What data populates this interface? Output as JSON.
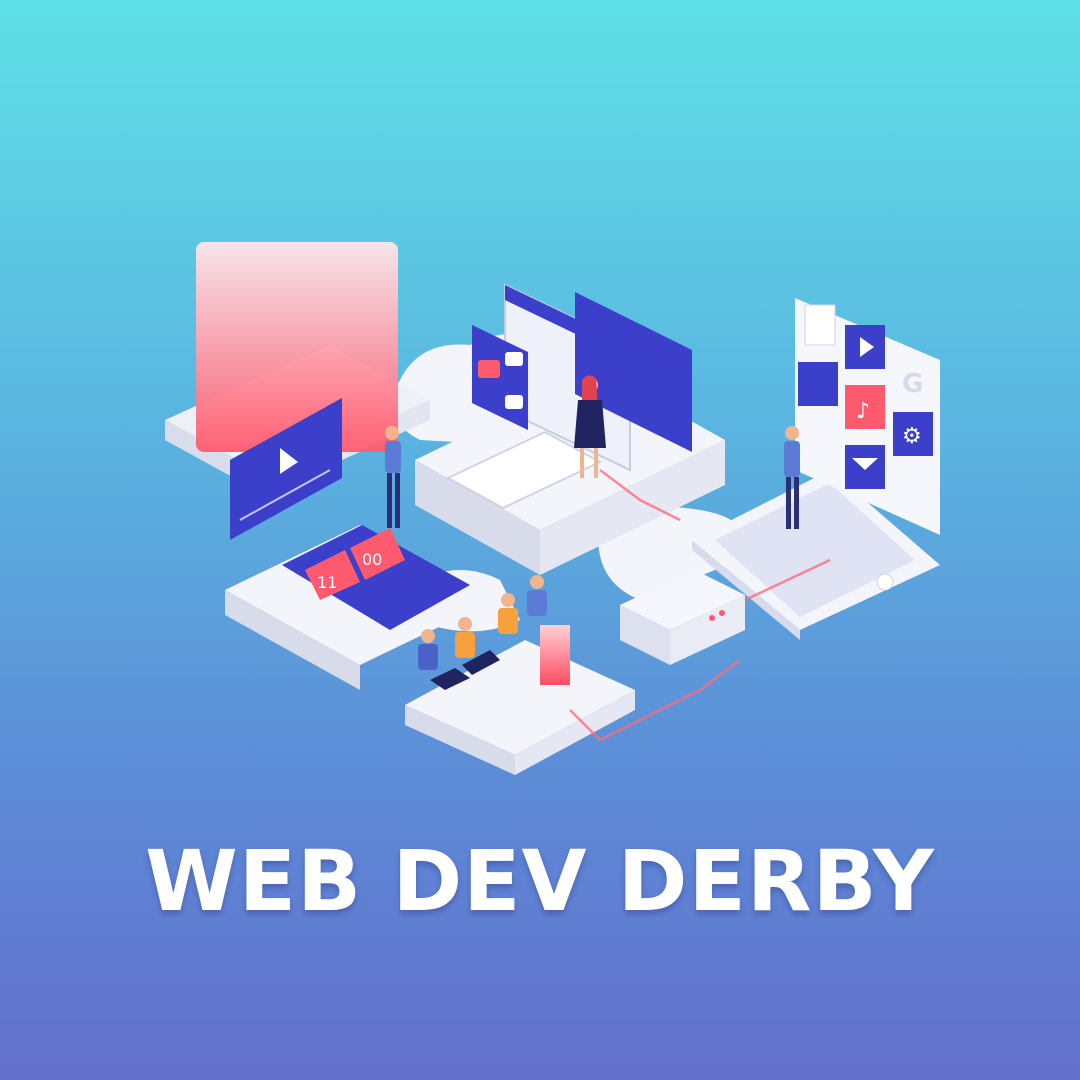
{
  "headline": "WEB DEV DERBY",
  "illustration": {
    "timer_hours": "11",
    "timer_minutes": "00",
    "icon_grid": [
      "cart-icon",
      "play-icon",
      "google-g-icon",
      "wifi-icon",
      "music-note-icon",
      "gear-icon",
      "mail-icon"
    ],
    "google_letter": "G"
  },
  "colors": {
    "background_top": "#5fe0e6",
    "background_bottom": "#6470cc",
    "accent_blue": "#3b3fc9",
    "accent_red": "#ff5a6e",
    "platform_white": "#f1f3fa"
  }
}
